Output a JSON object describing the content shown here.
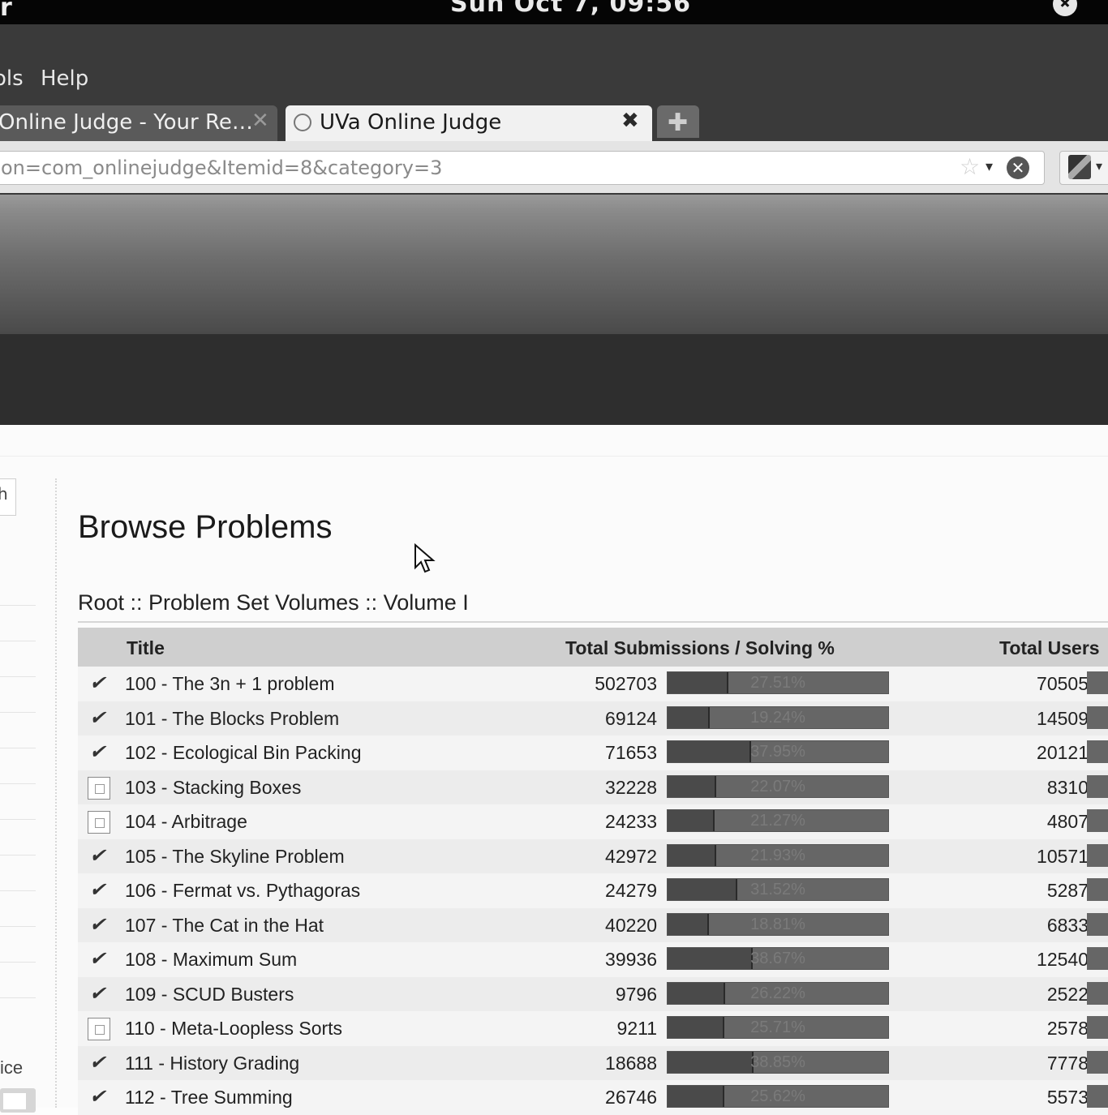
{
  "system_bar": {
    "left_glyph": "r",
    "clock": "Sun Oct  7, 09:56"
  },
  "menu": {
    "items": [
      "ols",
      "Help"
    ]
  },
  "tabs": [
    {
      "label": "Online Judge - Your Re…",
      "active": false,
      "close": "✕"
    },
    {
      "label": "UVa Online Judge",
      "active": true,
      "close": "✖"
    }
  ],
  "new_tab_symbol": "✚",
  "url": "on=com_onlinejudge&Itemid=8&category=3",
  "urlbar_icons": {
    "star": "☆",
    "dropdown": "▾",
    "stop": "✕"
  },
  "search_engine": {
    "dropdown": "▾"
  },
  "sidebar": {
    "box_text": "h",
    "bottom_text": "ice"
  },
  "page": {
    "title": "Browse Problems",
    "breadcrumb": "Root :: Problem Set Volumes :: Volume I"
  },
  "table": {
    "headers": {
      "title": "Title",
      "submissions": "Total Submissions / Solving %",
      "users": "Total Users"
    },
    "rows": [
      {
        "icon": "tick-icon",
        "title": "100 - The 3n + 1 problem",
        "submissions": "502703",
        "solving": "27.51%",
        "solving_fraction": 0.2751,
        "users": "70505"
      },
      {
        "icon": "tick-icon",
        "title": "101 - The Blocks Problem",
        "submissions": "69124",
        "solving": "19.24%",
        "solving_fraction": 0.1924,
        "users": "14509"
      },
      {
        "icon": "tick-icon",
        "title": "102 - Ecological Bin Packing",
        "submissions": "71653",
        "solving": "37.95%",
        "solving_fraction": 0.3795,
        "users": "20121"
      },
      {
        "icon": "document-icon",
        "title": "103 - Stacking Boxes",
        "submissions": "32228",
        "solving": "22.07%",
        "solving_fraction": 0.2207,
        "users": "8310"
      },
      {
        "icon": "document-icon",
        "title": "104 - Arbitrage",
        "submissions": "24233",
        "solving": "21.27%",
        "solving_fraction": 0.2127,
        "users": "4807"
      },
      {
        "icon": "tick-icon",
        "title": "105 - The Skyline Problem",
        "submissions": "42972",
        "solving": "21.93%",
        "solving_fraction": 0.2193,
        "users": "10571"
      },
      {
        "icon": "tick-icon",
        "title": "106 - Fermat vs. Pythagoras",
        "submissions": "24279",
        "solving": "31.52%",
        "solving_fraction": 0.3152,
        "users": "5287"
      },
      {
        "icon": "tick-icon",
        "title": "107 - The Cat in the Hat",
        "submissions": "40220",
        "solving": "18.81%",
        "solving_fraction": 0.1881,
        "users": "6833"
      },
      {
        "icon": "tick-icon",
        "title": "108 - Maximum Sum",
        "submissions": "39936",
        "solving": "38.67%",
        "solving_fraction": 0.3867,
        "users": "12540"
      },
      {
        "icon": "tick-icon",
        "title": "109 - SCUD Busters",
        "submissions": "9796",
        "solving": "26.22%",
        "solving_fraction": 0.2622,
        "users": "2522"
      },
      {
        "icon": "document-icon",
        "title": "110 - Meta-Loopless Sorts",
        "submissions": "9211",
        "solving": "25.71%",
        "solving_fraction": 0.2571,
        "users": "2578"
      },
      {
        "icon": "tick-icon",
        "title": "111 - History Grading",
        "submissions": "18688",
        "solving": "38.85%",
        "solving_fraction": 0.3885,
        "users": "7778"
      },
      {
        "icon": "tick-icon",
        "title": "112 - Tree Summing",
        "submissions": "26746",
        "solving": "25.62%",
        "solving_fraction": 0.2562,
        "users": "5573"
      }
    ]
  }
}
